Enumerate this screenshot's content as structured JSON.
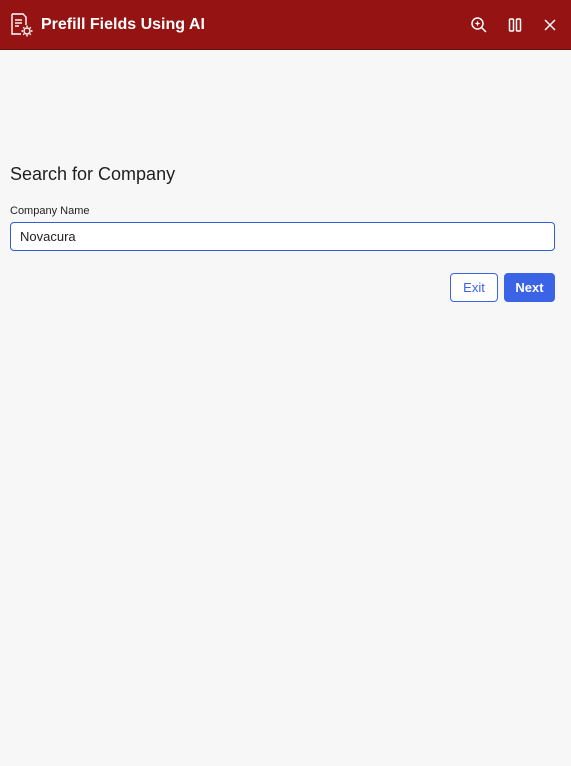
{
  "window": {
    "title": "Prefill Fields Using AI",
    "icons": {
      "app": "form-settings-icon",
      "zoom": "zoom-ai-icon",
      "split": "split-view-icon",
      "close": "close-icon"
    }
  },
  "form": {
    "heading": "Search for Company",
    "company_label": "Company Name",
    "company_value": "Novacura"
  },
  "actions": {
    "exit_label": "Exit",
    "next_label": "Next"
  },
  "colors": {
    "titlebar": "#951313",
    "accent": "#3b63e6",
    "background": "#f7f7f7"
  }
}
